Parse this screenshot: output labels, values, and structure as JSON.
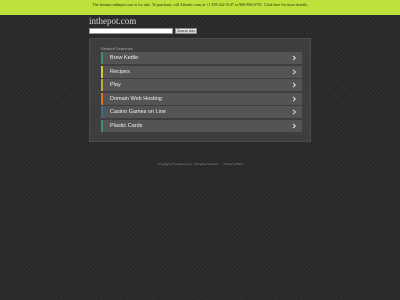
{
  "banner": {
    "text": "The domain inthepot.com is for sale. To purchase, call Afternic.com at +1 339-222-5147 or 866-836-6791. Click here for more details."
  },
  "site": {
    "name": "inthepot.com"
  },
  "search": {
    "placeholder": "",
    "button_label": "Search Ads"
  },
  "related": {
    "title": "Related Searches",
    "items": [
      {
        "label": "Brew Kettle",
        "color": "#3c8f7e"
      },
      {
        "label": "Recipes",
        "color": "#d9c23b"
      },
      {
        "label": "Play",
        "color": "#c9a93a"
      },
      {
        "label": "Domain Web Hosting",
        "color": "#d9712e"
      },
      {
        "label": "Casino Games on Line",
        "color": "#2f6f8f"
      },
      {
        "label": "Plastic Cards",
        "color": "#3c8f7e"
      }
    ]
  },
  "footer": {
    "copyright": "Copyright © inthepot.com . All rights reserved.",
    "separator": "|",
    "privacy": "Privacy Policy"
  }
}
